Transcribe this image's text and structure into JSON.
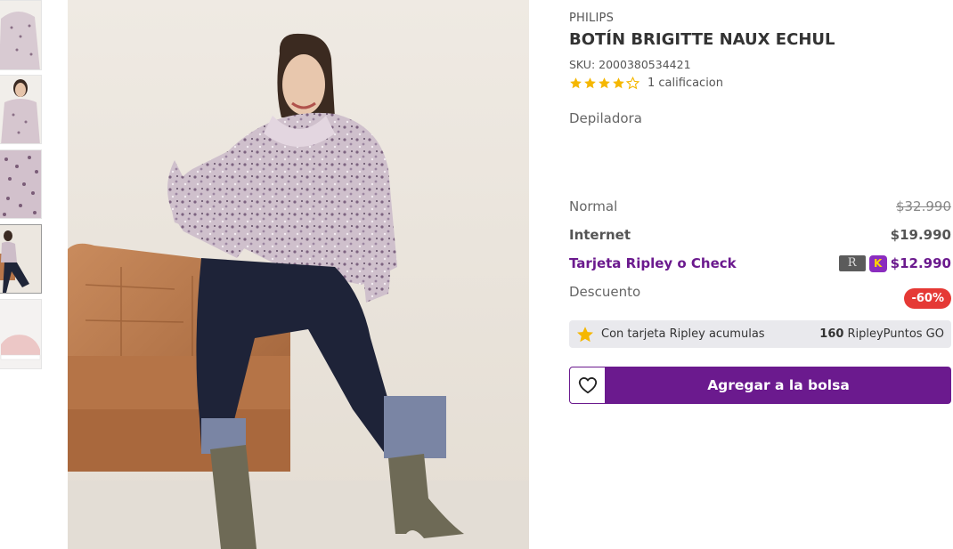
{
  "gallery": {
    "thumbnails": [
      {
        "name": "thumbnail-1",
        "tone": "#d9cbd2"
      },
      {
        "name": "thumbnail-2",
        "tone": "#d7c8cf"
      },
      {
        "name": "thumbnail-3",
        "tone": "#cdbac6"
      },
      {
        "name": "thumbnail-4",
        "tone": "#c9b9c4"
      },
      {
        "name": "thumbnail-5",
        "tone": "#e9c9c9"
      }
    ],
    "active_thumbnail": 4
  },
  "product": {
    "brand": "PHILIPS",
    "title": "BOTÍN BRIGITTE NAUX ECHUL",
    "sku": "SKU: 2000380534421",
    "rating": {
      "stars": 4,
      "max": 5,
      "text": "1 calificacion"
    },
    "description": "Depiladora"
  },
  "prices": {
    "normal_label": "Normal",
    "normal_value": "$32.990",
    "internet_label": "Internet",
    "internet_value": "$19.990",
    "card_label": "Tarjeta Ripley o Check",
    "card_value": "$12.990",
    "discount_label": "Descuento",
    "discount_value": "-60%"
  },
  "points": {
    "text": "Con tarjeta Ripley acumulas",
    "amount": "160",
    "unit": "RipleyPuntos GO"
  },
  "actions": {
    "add_to_bag": "Agregar a la bolsa"
  },
  "colors": {
    "brand_purple": "#6b1a8e",
    "discount_red": "#e53935",
    "star_gold": "#f5b700"
  }
}
